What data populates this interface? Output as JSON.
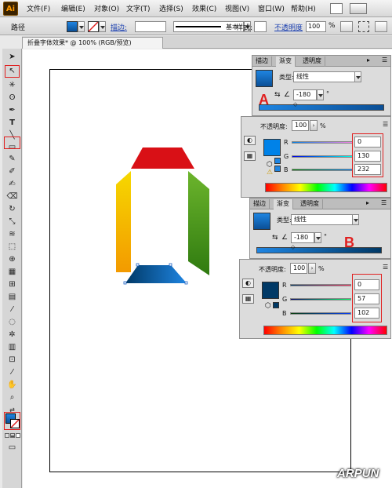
{
  "app": {
    "logo": "Ai"
  },
  "menu": [
    "文件(F)",
    "编辑(E)",
    "对象(O)",
    "文字(T)",
    "选择(S)",
    "效果(C)",
    "视图(V)",
    "窗口(W)",
    "帮助(H)"
  ],
  "control_bar": {
    "path_label": "路径",
    "stroke_label": "描边:",
    "stroke_profile": "基本",
    "style_label": "样式:",
    "opacity_label": "不透明度",
    "opacity_value": "100",
    "percent": "%"
  },
  "document_tab": {
    "title": "折叠字体效果* @ 100% (RGB/预览)"
  },
  "gradient_panel_a": {
    "tabs": [
      "描边",
      "渐变",
      "透明度"
    ],
    "type_label": "类型:",
    "type_value": "线性",
    "angle": "-180",
    "degree": "°",
    "marker": "A",
    "stop_colors": [
      "#1f85e2",
      "#0b4f96"
    ]
  },
  "color_panel_a": {
    "opacity_label": "不透明度:",
    "opacity_value": "100",
    "percent": "%",
    "r_label": "R",
    "g_label": "G",
    "b_label": "B",
    "r": "0",
    "g": "130",
    "b": "232",
    "swatch_color": "#0082e8"
  },
  "gradient_panel_b": {
    "tabs": [
      "描边",
      "渐变",
      "透明度"
    ],
    "type_label": "类型:",
    "type_value": "线性",
    "angle": "-180",
    "degree": "°",
    "marker": "B",
    "stop_colors": [
      "#1f85e2",
      "#003966"
    ]
  },
  "color_panel_b": {
    "opacity_label": "不透明度:",
    "opacity_value": "100",
    "percent": "%",
    "r_label": "R",
    "g_label": "G",
    "b_label": "B",
    "r": "0",
    "g": "57",
    "b": "102",
    "swatch_color": "#003966"
  },
  "artwork": {
    "top_shape_color": "#d91016",
    "left_bar_colors": [
      "#f6d800",
      "#f39a00"
    ],
    "right_bar_colors": [
      "#6cb52c",
      "#2f7a10"
    ],
    "bottom_shape_colors": [
      "#1f85e2",
      "#003966"
    ]
  },
  "watermark": "ARPUN"
}
